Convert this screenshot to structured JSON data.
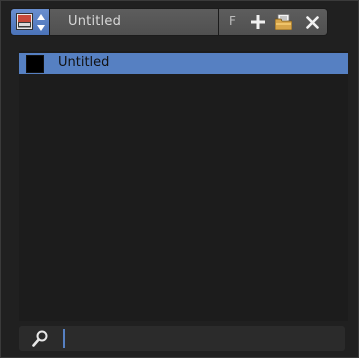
{
  "header": {
    "browse_icon": "image-browse-icon",
    "updown_icon": "updown-arrows-icon",
    "name": "Untitled",
    "fake_user_label": "F",
    "new_icon": "plus-icon",
    "open_icon": "folder-open-icon",
    "unlink_icon": "close-icon"
  },
  "list": {
    "items": [
      {
        "label": "Untitled",
        "swatch_color": "#000000",
        "selected": true
      }
    ]
  },
  "filter": {
    "icon": "search-icon",
    "value": ""
  },
  "colors": {
    "background": "#202020",
    "accent": "#5680c2",
    "button": "#555555"
  }
}
